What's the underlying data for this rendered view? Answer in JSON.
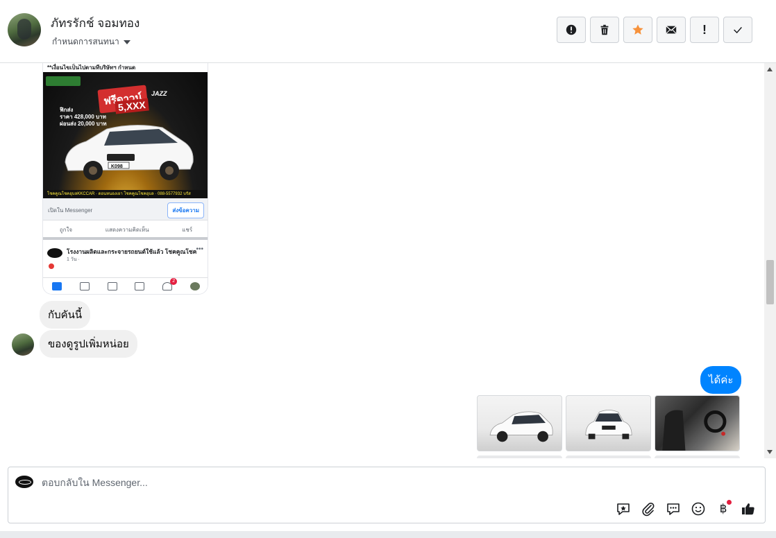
{
  "header": {
    "contact_name": "ภัทรรักช์ จอมทอง",
    "assign_label": "กำหนดการสนทนา",
    "actions": [
      {
        "name": "mark-spam-button",
        "icon": "alert-circle-icon"
      },
      {
        "name": "delete-button",
        "icon": "trash-icon"
      },
      {
        "name": "star-button",
        "icon": "star-icon"
      },
      {
        "name": "mark-unread-button",
        "icon": "envelope-icon"
      },
      {
        "name": "follow-up-button",
        "icon": "exclamation-icon",
        "glyph": "!"
      },
      {
        "name": "mark-done-button",
        "icon": "check-icon"
      }
    ],
    "star_color": "#f7923b"
  },
  "conversation": {
    "shared_screenshot": {
      "note": "**เงื่อนไขเป็นไปตามทีบริษัทฯ กำหนด",
      "ad_badge": "ฟรีดาวน์",
      "ad_badge_amount": "5,XXX",
      "ad_price_lines": [
        "ฟิกส่ง",
        "ราคา 428,000 บาท",
        "ผ่อนส่ง 20,000 บาท"
      ],
      "ad_brand": "JAZZ",
      "ad_plate": "K098",
      "ad_contact_strip": "โชคคูณโชคอุบลKKCCAR  ·  ดอนหนองเยา โชคคูณโชคอุบล  ·  088-5577932 บรัส",
      "open_in_messenger": "เปิดใน Messenger",
      "send_message": "ส่งข้อความ",
      "reactions": [
        "ถูกใจ",
        "แสดงความคิดเห็น",
        "แชร์"
      ],
      "post_title": "โรงงานผลิตและกระจายรถยนต์ใช้แล้ว โชคคูณโชค",
      "post_time": "1 วัน · ",
      "notification_count": "2"
    },
    "messages": [
      {
        "direction": "incoming",
        "text": "กับคันนี้"
      },
      {
        "direction": "incoming",
        "text": "ของดูรูปเพิ่มหน่อย"
      },
      {
        "direction": "outgoing",
        "text": "ได้ค่ะ"
      }
    ],
    "outgoing_bubble_color": "#0084ff",
    "photos": [
      {
        "subject": "white hatchback front-left"
      },
      {
        "subject": "white hatchback front"
      },
      {
        "subject": "interior driver seat"
      }
    ]
  },
  "composer": {
    "placeholder": "ตอบกลับใน Messenger...",
    "tools": [
      {
        "name": "saved-reply-button",
        "icon": "saved-reply-icon"
      },
      {
        "name": "attach-button",
        "icon": "paperclip-icon"
      },
      {
        "name": "quick-reply-button",
        "icon": "chat-bubbles-icon"
      },
      {
        "name": "emoji-button",
        "icon": "smiley-icon"
      },
      {
        "name": "payment-button",
        "icon": "baht-icon",
        "glyph": "฿"
      },
      {
        "name": "like-button",
        "icon": "thumbs-up-icon"
      }
    ]
  }
}
